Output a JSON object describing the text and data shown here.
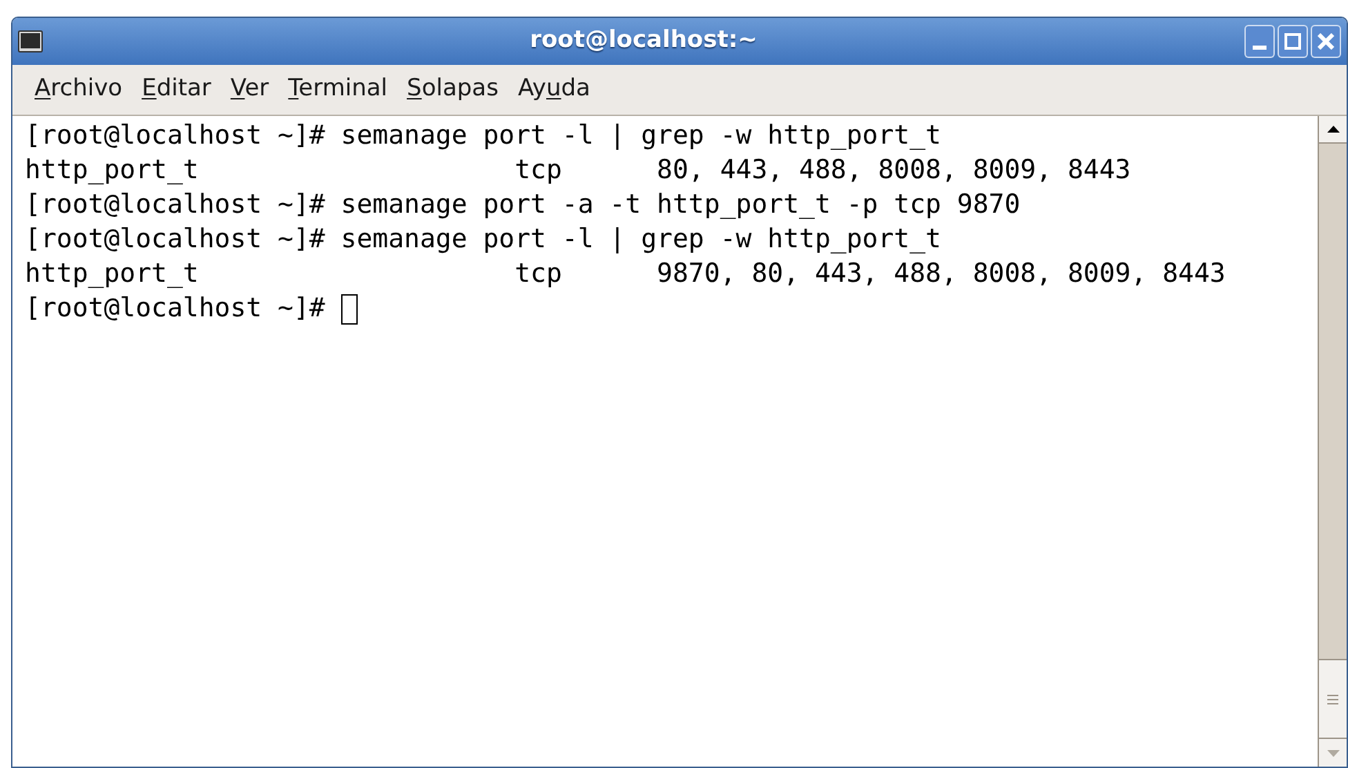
{
  "window": {
    "title": "root@localhost:~"
  },
  "menu": [
    {
      "mnemonic": "A",
      "rest": "rchivo"
    },
    {
      "mnemonic": "E",
      "rest": "ditar"
    },
    {
      "mnemonic": "V",
      "rest": "er"
    },
    {
      "mnemonic": "T",
      "rest": "erminal"
    },
    {
      "mnemonic": "S",
      "rest": "olapas"
    },
    {
      "before": "Ay",
      "mnemonic": "u",
      "rest": "da"
    }
  ],
  "terminal": {
    "lines": [
      "[root@localhost ~]# semanage port -l | grep -w http_port_t",
      "http_port_t                    tcp      80, 443, 488, 8008, 8009, 8443",
      "[root@localhost ~]# semanage port -a -t http_port_t -p tcp 9870",
      "[root@localhost ~]# semanage port -l | grep -w http_port_t",
      "http_port_t                    tcp      9870, 80, 443, 488, 8008, 8009, 8443"
    ],
    "prompt": "[root@localhost ~]# ",
    "cursor": true
  }
}
